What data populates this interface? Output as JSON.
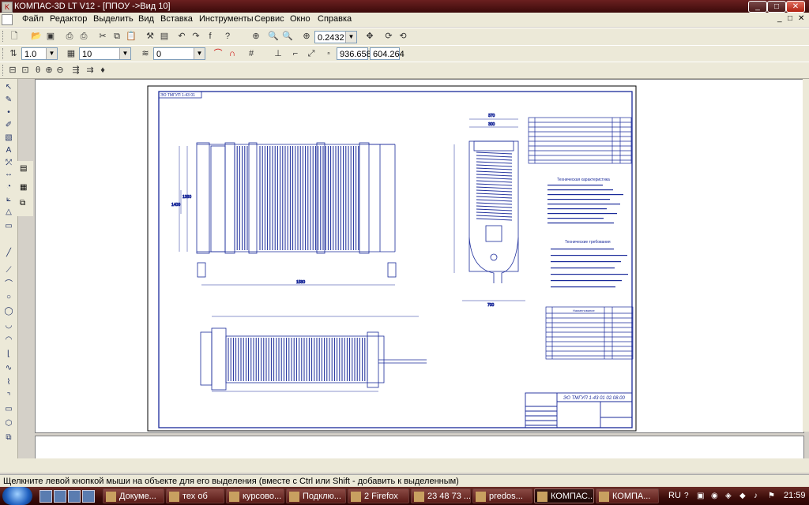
{
  "window": {
    "title": "КОМПАС-3D LT V12 - [ППОУ ->Вид 10]"
  },
  "menu": [
    "Файл",
    "Редактор",
    "Выделить",
    "Вид",
    "Вставка",
    "Инструменты",
    "Сервис",
    "Окно",
    "Справка"
  ],
  "toolbar": {
    "zoom_value": "0.2432",
    "line_style": "1.0",
    "layer_value": "10",
    "state_value": "0",
    "coord_x": "936.658",
    "coord_y": "604.264"
  },
  "status_text": "Щелкните левой кнопкой мыши на объекте для его выделения (вместе с Ctrl или Shift - добавить к выделенным)",
  "drawing": {
    "title_block_line1": "ЭО ТМГУП 1-43 01 02.08.00",
    "tech_header": "Техническая характеристика",
    "req_header": "Технические требования",
    "spec_header": "Наименование"
  },
  "taskbar": {
    "tasks": [
      "Докуме...",
      "тех об",
      "курсово...",
      "Подклю...",
      "2 Firefox",
      "23 48 73 ...",
      "predos...",
      "КОМПАС...",
      "КОМПА..."
    ],
    "active_index": 7,
    "lang": "RU",
    "clock": "21:59"
  },
  "icons": [
    "app-icon",
    "new-icon",
    "open-icon",
    "save-icon",
    "print-icon",
    "cut-icon",
    "copy-icon",
    "paste-icon",
    "undo-icon",
    "redo-icon",
    "zoom-icon",
    "pan-icon",
    "start-icon"
  ]
}
